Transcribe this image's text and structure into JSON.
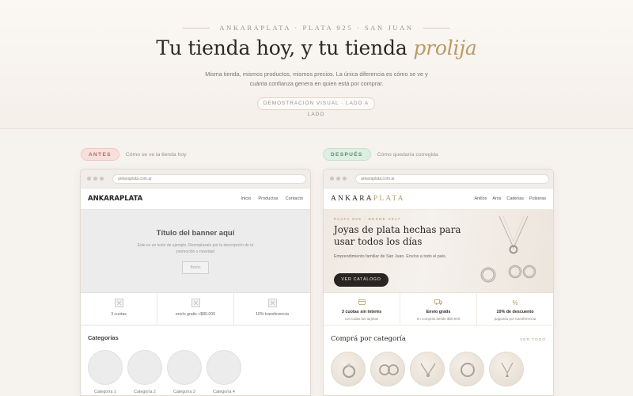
{
  "hero": {
    "eyebrow": "ANKARAPLATA · PLATA 925 · SAN JUAN",
    "title_main": "Tu tienda hoy, y tu tienda ",
    "title_accent": "prolija",
    "subtitle": "Misma tienda, mismos productos, mismos precios. La única diferencia es cómo se ve y cuánta confianza genera en quien está por comprar.",
    "pill": "DEMOSTRACIÓN VISUAL · LADO A LADO"
  },
  "before": {
    "tag": "ANTES",
    "caption": "Cómo se ve la tienda hoy",
    "url": "ankaraplata.com.ar",
    "logo": "ANKARAPLATA",
    "nav": [
      "Inicio",
      "Productos",
      "Contacto"
    ],
    "banner_title": "Título del banner aquí",
    "banner_text": "Este es un texto de ejemplo. Reemplazalo por la descripción de tu promoción o novedad",
    "banner_button": "Botón",
    "features": [
      "3 cuotas",
      "envío gratis +$80.000",
      "10% transferencia"
    ],
    "categories_title": "Categorías",
    "categories": [
      "Categoría 1",
      "Categoría 2",
      "Categoría 3",
      "Categoría 4"
    ]
  },
  "after": {
    "tag": "DESPUÉS",
    "caption": "Cómo quedaría corregida",
    "url": "ankaraplata.com.ar",
    "logo_part1": "ANKARA",
    "logo_part2": "PLATA",
    "nav": [
      "Anillos",
      "Aros",
      "Cadenas",
      "Pulseras"
    ],
    "banner_eyebrow": "PLATA 925 · DESDE 2017",
    "banner_title": "Joyas de plata hechas para usar todos los días",
    "banner_text": "Emprendimiento familiar de San Juan. Envíos a todo el país.",
    "banner_button": "VER CATÁLOGO",
    "features": [
      {
        "icon": "card-icon",
        "title": "3 cuotas sin interés",
        "sub": "con todas las tarjetas"
      },
      {
        "icon": "truck-icon",
        "title": "Envío gratis",
        "sub": "en compras desde $80.000"
      },
      {
        "icon": "percent-icon",
        "title": "10% de descuento",
        "sub": "pagando por transferencia"
      }
    ],
    "categories_title": "Comprá por categoría",
    "categories_link": "VER TODO",
    "category_icons": [
      "ring-icon",
      "earrings-icon",
      "necklace-icon",
      "bracelet-icon",
      "pendant-icon"
    ]
  },
  "colors": {
    "accent": "#b89a66",
    "dark": "#2a2521",
    "antes": "#b36a62",
    "despues": "#5e8a68"
  }
}
